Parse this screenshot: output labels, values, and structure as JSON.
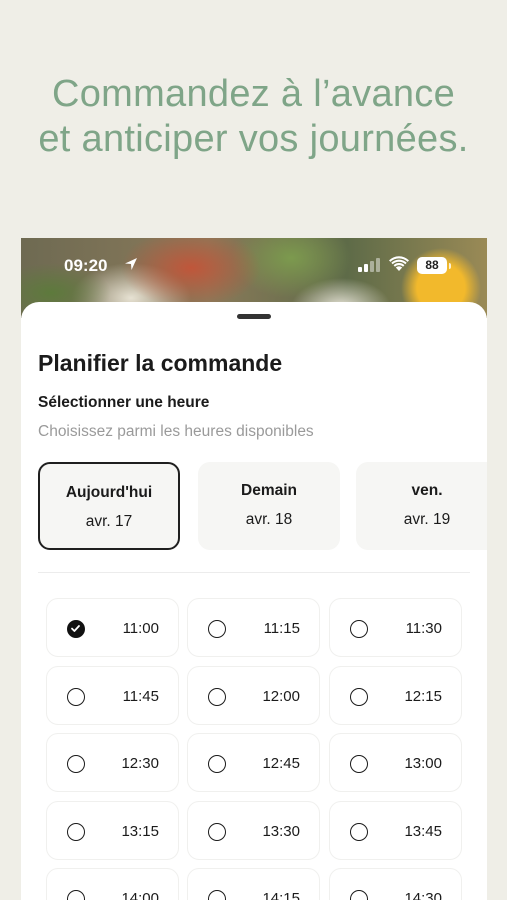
{
  "headline": {
    "line1": "Commandez à l’avance",
    "line2": "et anticiper vos journées."
  },
  "status_bar": {
    "time": "09:20",
    "battery": "88"
  },
  "sheet": {
    "title": "Planifier la commande",
    "section_title": "Sélectionner une heure",
    "section_subtitle": "Choisissez parmi les heures disponibles"
  },
  "days": [
    {
      "name": "Aujourd'hui",
      "date": "avr. 17",
      "selected": true
    },
    {
      "name": "Demain",
      "date": "avr. 18",
      "selected": false
    },
    {
      "name": "ven.",
      "date": "avr. 19",
      "selected": false
    }
  ],
  "slots": [
    {
      "time": "11:00",
      "selected": true
    },
    {
      "time": "11:15",
      "selected": false
    },
    {
      "time": "11:30",
      "selected": false
    },
    {
      "time": "11:45",
      "selected": false
    },
    {
      "time": "12:00",
      "selected": false
    },
    {
      "time": "12:15",
      "selected": false
    },
    {
      "time": "12:30",
      "selected": false
    },
    {
      "time": "12:45",
      "selected": false
    },
    {
      "time": "13:00",
      "selected": false
    },
    {
      "time": "13:15",
      "selected": false
    },
    {
      "time": "13:30",
      "selected": false
    },
    {
      "time": "13:45",
      "selected": false
    },
    {
      "time": "14:00",
      "selected": false
    },
    {
      "time": "14:15",
      "selected": false
    },
    {
      "time": "14:30",
      "selected": false
    }
  ],
  "icons": {
    "location": "location-arrow-icon",
    "signal": "cellular-signal-icon",
    "wifi": "wifi-icon",
    "battery": "battery-icon",
    "check": "check-icon"
  },
  "colors": {
    "background": "#efeee7",
    "headline": "#7fa588",
    "text": "#1b1b1b",
    "muted": "#9a9a9a"
  }
}
